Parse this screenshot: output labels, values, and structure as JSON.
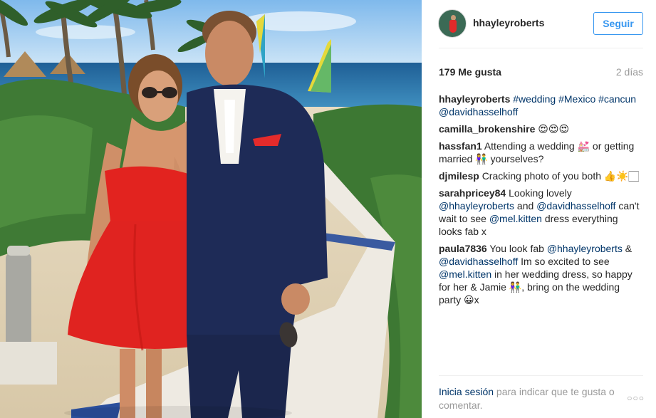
{
  "post": {
    "photo_alt": "Photo",
    "author": "hhayleyroberts",
    "follow_label": "Seguir",
    "likes": "179 Me gusta",
    "time": "2 días"
  },
  "comments": [
    {
      "user": "hhayleyroberts",
      "parts": [
        {
          "t": "tag",
          "v": "#wedding"
        },
        {
          "t": "txt",
          "v": " "
        },
        {
          "t": "tag",
          "v": "#Mexico"
        },
        {
          "t": "txt",
          "v": " "
        },
        {
          "t": "tag",
          "v": "#cancun"
        },
        {
          "t": "txt",
          "v": " "
        },
        {
          "t": "tag",
          "v": "@davidhasselhoff"
        }
      ]
    },
    {
      "user": "camilla_brokenshire",
      "parts": [
        {
          "t": "txt",
          "v": "😍😍😍"
        }
      ]
    },
    {
      "user": "hassfan1",
      "parts": [
        {
          "t": "txt",
          "v": "Attending a wedding 💒 or getting married 👫 yourselves?"
        }
      ]
    },
    {
      "user": "djmilesp",
      "parts": [
        {
          "t": "txt",
          "v": "Cracking photo of you both 👍☀️🏻"
        }
      ]
    },
    {
      "user": "sarahpricey84",
      "parts": [
        {
          "t": "txt",
          "v": "Looking lovely "
        },
        {
          "t": "tag",
          "v": "@hhayleyroberts"
        },
        {
          "t": "txt",
          "v": " and "
        },
        {
          "t": "tag",
          "v": "@davidhasselhoff"
        },
        {
          "t": "txt",
          "v": " can't wait to see "
        },
        {
          "t": "tag",
          "v": "@mel.kitten"
        },
        {
          "t": "txt",
          "v": " dress everything looks fab x"
        }
      ]
    },
    {
      "user": "paula7836",
      "parts": [
        {
          "t": "txt",
          "v": "You look fab "
        },
        {
          "t": "tag",
          "v": "@hhayleyroberts"
        },
        {
          "t": "txt",
          "v": " & "
        },
        {
          "t": "tag",
          "v": "@davidhasselhoff"
        },
        {
          "t": "txt",
          "v": " Im so excited to see "
        },
        {
          "t": "tag",
          "v": "@mel.kitten"
        },
        {
          "t": "txt",
          "v": " in her wedding dress, so happy for her & Jamie 👫, bring on the wedding party 😀x"
        }
      ]
    }
  ],
  "footer": {
    "login_label": "Inicia sesión",
    "rest": " para indicar que te gusta o comentar.",
    "more_icon": "ellipsis-icon",
    "more_glyph": "○○○"
  },
  "colors": {
    "accent": "#3897f0",
    "link": "#003569",
    "muted": "#999999"
  }
}
